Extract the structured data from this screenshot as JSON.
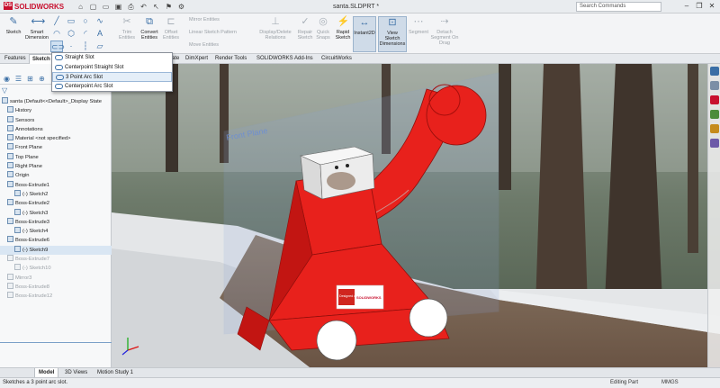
{
  "titlebar": {
    "brand": "SOLIDWORKS",
    "brand_mark": "DS",
    "doc_title": "santa.SLDPRT *",
    "search_placeholder": "Search Commands",
    "quick_access": [
      "home-icon",
      "new-icon",
      "open-icon",
      "save-icon",
      "print-icon",
      "undo-icon",
      "select-icon",
      "rebuild-icon",
      "options-icon"
    ]
  },
  "ribbon": {
    "sketch": "Sketch",
    "smart_dimension": "Smart Dimension",
    "trim_entities": "Trim Entities",
    "convert_entities": "Convert Entities",
    "offset_entities": "Offset Entities",
    "mirror_entities": "Mirror Entities",
    "linear_sketch_pattern": "Linear Sketch Pattern",
    "move_entities": "Move Entities",
    "display_delete_relations": "Display/Delete Relations",
    "repair_sketch": "Repair Sketch",
    "quick_snaps": "Quick Snaps",
    "rapid_sketch": "Rapid Sketch",
    "instant2d": "Instant2D",
    "view_sketch_dimensions": "View Sketch Dimensions",
    "segment": "Segment",
    "detach_segment": "Detach Segment On Drag"
  },
  "command_tabs": [
    "Features",
    "Sketch",
    "ate",
    "DimXpert",
    "Render Tools",
    "SOLIDWORKS Add-Ins",
    "CircuitWorks"
  ],
  "slot_menu": {
    "items": [
      {
        "label": "Straight Slot"
      },
      {
        "label": "Centerpoint Straight Slot"
      },
      {
        "label": "3 Point Arc Slot"
      },
      {
        "label": "Centerpoint Arc Slot"
      }
    ]
  },
  "feature_tree": {
    "root": "santa  (Default<<Default>_Display State",
    "items": [
      {
        "label": "History"
      },
      {
        "label": "Sensors"
      },
      {
        "label": "Annotations"
      },
      {
        "label": "Material <not specified>"
      },
      {
        "label": "Front Plane"
      },
      {
        "label": "Top Plane"
      },
      {
        "label": "Right Plane"
      },
      {
        "label": "Origin"
      },
      {
        "label": "Boss-Extrude1"
      },
      {
        "label": "(-) Sketch2"
      },
      {
        "label": "Boss-Extrude2"
      },
      {
        "label": "(-) Sketch3"
      },
      {
        "label": "Boss-Extrude3"
      },
      {
        "label": "(-) Sketch4"
      },
      {
        "label": "Boss-Extrude6"
      },
      {
        "label": "(-) Sketch9"
      },
      {
        "label": "Boss-Extrude7"
      },
      {
        "label": "(-) Sketch10"
      },
      {
        "label": "Mirror3"
      },
      {
        "label": "Boss-Extrude8"
      },
      {
        "label": "Boss-Extrude12"
      }
    ]
  },
  "viewport": {
    "plane_label": "Front Plane",
    "decal_line1": "Designed with",
    "decal_line2": "SOLIDWORKS",
    "colors": {
      "body": "#e8211c",
      "body_shade": "#c21512",
      "head": "#ececec",
      "wheel": "#ffffff",
      "plane": "#7f9fd8"
    }
  },
  "bottom_tabs": [
    "Model",
    "3D Views",
    "Motion Study 1"
  ],
  "status": {
    "message": "Sketches a 3 point arc slot.",
    "mode": "Editing Part",
    "units": "MMGS"
  }
}
